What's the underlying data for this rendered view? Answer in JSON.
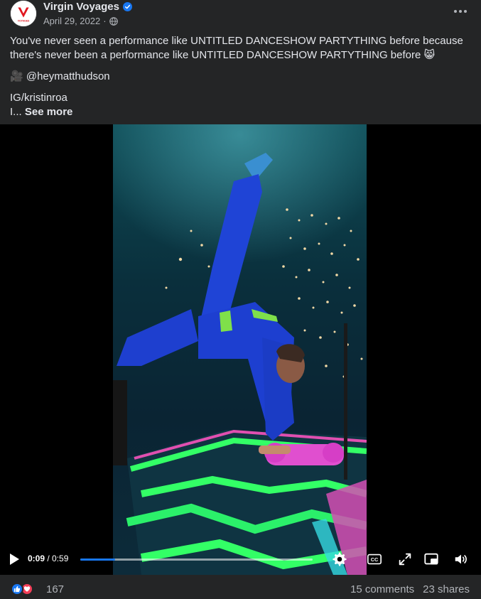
{
  "post": {
    "page_name": "Virgin Voyages",
    "date": "April 29, 2022",
    "separator": "·",
    "avatar_text": "VOYAGES",
    "caption": {
      "line1": "You've never seen a performance like UNTITLED DANCESHOW PARTYTHING before because there's never been a performance like UNTITLED DANCESHOW PARTYTHING before 😸",
      "credit": "🎥 @heymatthudson",
      "ig": "IG/kristinroa",
      "truncated": "I...",
      "see_more": "See more"
    }
  },
  "video": {
    "current_time": "0:09",
    "duration": " / 0:59",
    "progress": 0.15,
    "controls": [
      "settings-gear",
      "closed-captions",
      "fullscreen",
      "picture-in-picture",
      "volume"
    ]
  },
  "footer": {
    "reaction_count": "167",
    "comments": "15 comments",
    "shares": "23 shares"
  },
  "colors": {
    "background": "#242526",
    "accent": "#1877f2",
    "love": "#f33e58",
    "text_primary": "#e4e6eb",
    "text_secondary": "#b0b3b8",
    "brand_red": "#e1161f"
  }
}
